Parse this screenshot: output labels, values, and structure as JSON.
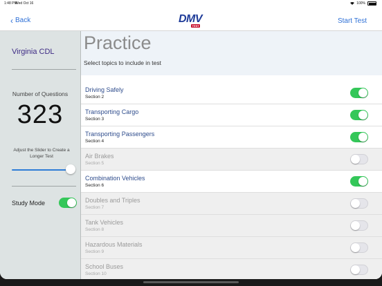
{
  "status": {
    "time": "1:48 PM",
    "date": "Wed Oct 16",
    "battery": "100%"
  },
  "nav": {
    "back_label": "Back",
    "start_label": "Start Test",
    "logo_text": "DMV",
    "logo_badge": "TEST"
  },
  "sidebar": {
    "title": "Virginia CDL",
    "questions_label": "Number of Questions",
    "questions_value": "323",
    "slider_hint": "Adjust the Slider to Create a Longer Test",
    "slider_level": 1.0,
    "study_mode_label": "Study Mode",
    "study_mode_on": true
  },
  "main": {
    "title": "Practice",
    "subtitle": "Select topics to include in test",
    "topics": [
      {
        "title": "Driving Safely",
        "section": "Section 2",
        "on": true
      },
      {
        "title": "Transporting Cargo",
        "section": "Section 3",
        "on": true
      },
      {
        "title": "Transporting Passengers",
        "section": "Section 4",
        "on": true
      },
      {
        "title": "Air Brakes",
        "section": "Section 5",
        "on": false
      },
      {
        "title": "Combination Vehicles",
        "section": "Section 6",
        "on": true
      },
      {
        "title": "Doubles and Triples",
        "section": "Section 7",
        "on": false
      },
      {
        "title": "Tank Vehicles",
        "section": "Section 8",
        "on": false
      },
      {
        "title": "Hazardous Materials",
        "section": "Section 9",
        "on": false
      },
      {
        "title": "School Buses",
        "section": "Section 10",
        "on": false
      }
    ]
  },
  "colors": {
    "accent": "#2d6fd6",
    "toggle_on": "#34c759",
    "sidebar_bg": "#dde3e3",
    "title_purple": "#3d2a84"
  }
}
